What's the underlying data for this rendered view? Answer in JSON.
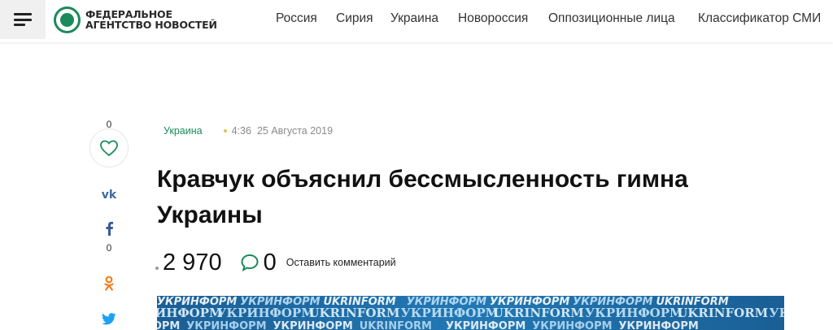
{
  "header": {
    "logo_line1": "ФЕДЕРАЛЬНОЕ",
    "logo_line2": "АГЕНТСТВО НОВОСТЕЙ",
    "nav": [
      {
        "label": "Россия"
      },
      {
        "label": "Сирия"
      },
      {
        "label": "Украина"
      },
      {
        "label": "Новороссия"
      },
      {
        "label": "Оппозиционные лица"
      },
      {
        "label": "Классификатор СМИ"
      }
    ]
  },
  "share": {
    "likes": "0",
    "facebook_count": "0"
  },
  "article": {
    "category": "Украина",
    "time": "4:36",
    "date": "25 Августа 2019",
    "title": "Кравчук объяснил бессмысленность гимна Украины",
    "views": "2 970",
    "comments": "0",
    "leave_comment": "Оставить комментарий"
  },
  "image": {
    "row1": [
      "УКРИНФОРМ",
      "УКРИНФОРМ",
      "UKRINFORM",
      "УКРИНФОРМ",
      "УКРИНФОРМ",
      "УКРИНФОРМ",
      "UKRINFORM"
    ],
    "row2": [
      "УКРИНФОРМ",
      "УКРИНФОРМ",
      "UKRINFORM",
      "УКРИНФОРМ",
      "UKRINFORM",
      "УКРИНФОРМ",
      "UKRINFORM",
      "УКРИНФОРМ"
    ],
    "row3": [
      "УКРИНФОРМ",
      "УКРИНФОРМ",
      "УКРИНФОРМ",
      "UKRINFORM",
      "УКРИНФОРМ",
      "УКРИНФОРМ",
      "УКРИНФОРМ"
    ]
  },
  "colors": {
    "brand_green": "#1b8a5a",
    "image_blue": "#1b6ca8",
    "vk_blue": "#3b6aa0",
    "ok_orange": "#f08020",
    "twitter_blue": "#1da1f2",
    "comment_green": "#1b8a5a"
  }
}
